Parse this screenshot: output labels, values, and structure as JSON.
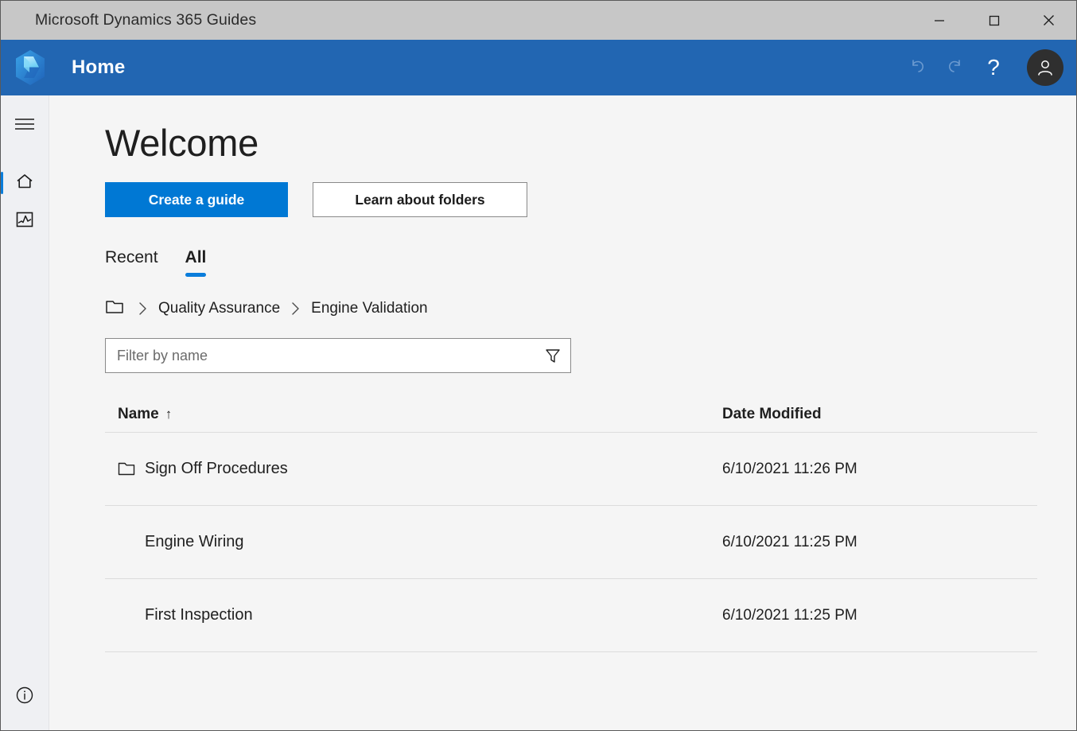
{
  "window": {
    "title": "Microsoft Dynamics 365 Guides",
    "controls": {
      "minimize": "minimize-button",
      "maximize": "maximize-button",
      "close": "close-button"
    }
  },
  "header": {
    "app_title": "Home",
    "logo_name": "dynamics-365-guides-logo",
    "actions": {
      "undo": "undo-icon",
      "redo": "redo-icon",
      "help": "?",
      "account": "user-avatar"
    }
  },
  "sidebar": {
    "items": [
      {
        "name": "hamburger-menu",
        "label": "Menu",
        "selected": false
      },
      {
        "name": "home",
        "label": "Home",
        "selected": true
      },
      {
        "name": "analytics",
        "label": "Analytics",
        "selected": false
      }
    ],
    "footer": {
      "name": "info",
      "label": "Info"
    }
  },
  "main": {
    "page_title": "Welcome",
    "buttons": {
      "create_guide": "Create a guide",
      "learn_folders": "Learn about folders"
    },
    "tabs": [
      {
        "label": "Recent",
        "active": false
      },
      {
        "label": "All",
        "active": true
      }
    ],
    "breadcrumb": {
      "root_icon": "folder-icon",
      "items": [
        "Quality Assurance",
        "Engine Validation"
      ],
      "separator": "›"
    },
    "filter": {
      "placeholder": "Filter by name",
      "value": "",
      "icon": "filter-funnel-icon"
    },
    "table": {
      "columns": [
        {
          "key": "name",
          "label": "Name",
          "sort": "↑"
        },
        {
          "key": "date",
          "label": "Date Modified",
          "sort": ""
        }
      ],
      "rows": [
        {
          "name": "Sign Off Procedures",
          "date": "6/10/2021 11:26 PM",
          "icon": "folder-icon"
        },
        {
          "name": "Engine Wiring",
          "date": "6/10/2021 11:25 PM",
          "icon": ""
        },
        {
          "name": "First Inspection",
          "date": "6/10/2021 11:25 PM",
          "icon": ""
        }
      ]
    }
  },
  "colors": {
    "header_blue": "#2266b2",
    "accent_blue": "#0078d4",
    "tab_indicator": "#0a7ddb",
    "titlebar_gray": "#c7c7c7",
    "rail_bg": "#eff0f3",
    "content_bg": "#f5f5f5",
    "divider": "#dcdcdc"
  }
}
